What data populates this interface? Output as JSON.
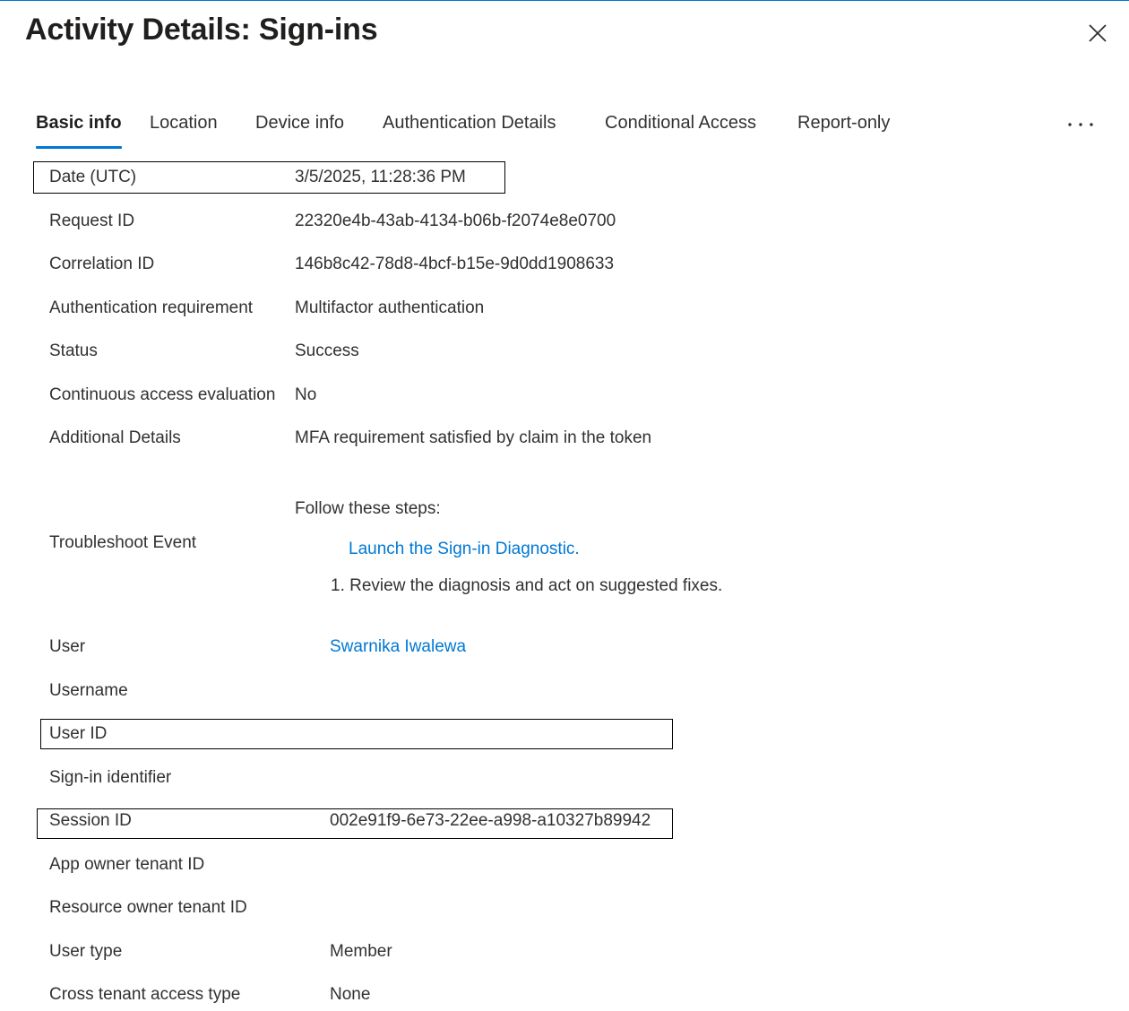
{
  "dialog": {
    "title": "Activity Details: Sign-ins"
  },
  "tabs": [
    {
      "label": "Basic info"
    },
    {
      "label": "Location"
    },
    {
      "label": "Device info"
    },
    {
      "label": "Authentication Details"
    },
    {
      "label": "Conditional Access"
    },
    {
      "label": "Report-only"
    }
  ],
  "fields": {
    "date": {
      "label": "Date (UTC)",
      "value": "3/5/2025, 11:28:36 PM"
    },
    "request_id": {
      "label": "Request ID",
      "value": "22320e4b-43ab-4134-b06b-f2074e8e0700"
    },
    "correlation_id": {
      "label": "Correlation ID",
      "value": "146b8c42-78d8-4bcf-b15e-9d0dd1908633"
    },
    "auth_requirement": {
      "label": "Authentication requirement",
      "value": "Multifactor authentication"
    },
    "status": {
      "label": "Status",
      "value": "Success"
    },
    "cae": {
      "label": "Continuous access evaluation",
      "value": "No"
    },
    "additional_details": {
      "label": "Additional Details",
      "value": "MFA requirement satisfied by claim in the token"
    },
    "troubleshoot": {
      "label": "Troubleshoot Event",
      "intro": "Follow these steps:",
      "link": "Launch the Sign-in Diagnostic.",
      "step": "1. Review the diagnosis and act on suggested fixes."
    },
    "user": {
      "label": "User",
      "value": "Swarnika Iwalewa"
    },
    "username": {
      "label": "Username",
      "value": ""
    },
    "user_id": {
      "label": "User ID",
      "value": ""
    },
    "signin_identifier": {
      "label": "Sign-in identifier",
      "value": ""
    },
    "session_id": {
      "label": "Session ID",
      "value": "002e91f9-6e73-22ee-a998-a10327b89942"
    },
    "app_owner_tenant": {
      "label": "App owner tenant ID",
      "value": ""
    },
    "resource_owner_tenant": {
      "label": "Resource owner tenant ID",
      "value": ""
    },
    "user_type": {
      "label": "User type",
      "value": "Member"
    },
    "cross_tenant": {
      "label": "Cross tenant access type",
      "value": "None"
    }
  },
  "icons": {
    "close": "close-icon",
    "more": "more-options-icon"
  },
  "colors": {
    "accent": "#0078d4",
    "text": "#323130"
  }
}
